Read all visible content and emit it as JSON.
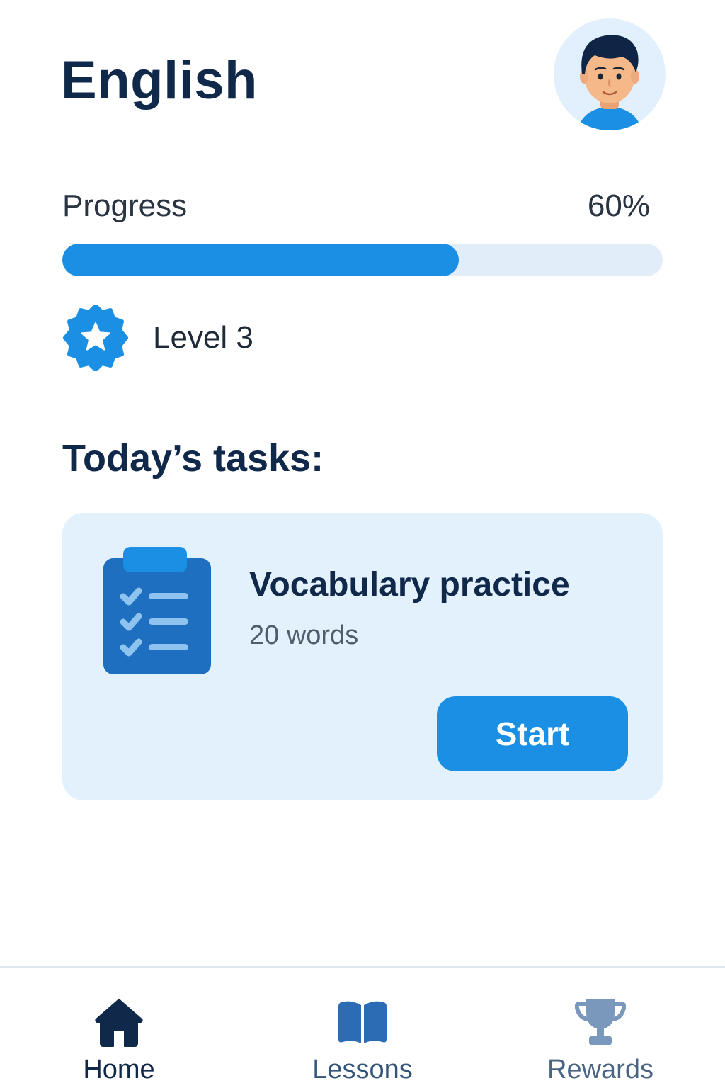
{
  "header": {
    "title": "English",
    "avatar_icon": "user-avatar-icon"
  },
  "progress": {
    "label": "Progress",
    "value_text": "60%",
    "fraction": 0.66
  },
  "level": {
    "label": "Level 3",
    "icon": "star-badge-icon"
  },
  "tasks": {
    "heading": "Today’s tasks:",
    "items": [
      {
        "icon": "clipboard-checklist-icon",
        "title": "Vocabulary practice",
        "subtitle": "20 words",
        "button_label": "Start"
      }
    ]
  },
  "bottom_nav": {
    "items": [
      {
        "label": "Home",
        "icon": "home-icon",
        "active": true
      },
      {
        "label": "Lessons",
        "icon": "book-icon",
        "active": false
      },
      {
        "label": "Rewards",
        "icon": "trophy-icon",
        "active": false
      }
    ]
  },
  "colors": {
    "primary": "#1a8fe3",
    "text_dark": "#10284a",
    "card_bg": "#e3f1fc",
    "track_bg": "#e1eefa"
  }
}
